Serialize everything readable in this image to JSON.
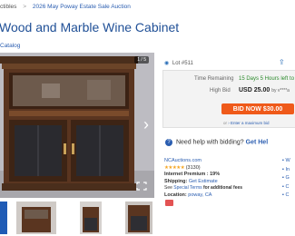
{
  "breadcrumb": {
    "items": [
      "ctibles",
      "2026 May Poway Estate Sale Auction"
    ]
  },
  "listing": {
    "title": "Wood and Marble Wine Cabinet",
    "catalog_link": "Catalog"
  },
  "gallery": {
    "counter": "1 / 5"
  },
  "lot": {
    "number": "Lot #511"
  },
  "bidding": {
    "time_remaining_label": "Time Remaining",
    "time_remaining_value": "15 Days 5 Hours left to",
    "high_bid_label": "High Bid",
    "high_bid_value": "USD 25.00",
    "high_bid_by": "by v****a",
    "bid_now_label": "BID NOW $30.00",
    "or_text": "or",
    "max_bid_link": "Enter a maximum bid"
  },
  "help": {
    "text": "Need help with bidding?",
    "link": "Get Hel"
  },
  "seller": {
    "name": "NCAuctions.com",
    "stars": "★★★★★",
    "rating_count": "(3130)",
    "premium": "Internet Premium : 19%",
    "shipping_label": "Shipping:",
    "shipping_value": "Get Estimate",
    "terms_see": "See",
    "terms_link": "Special Terms",
    "terms_rest": "for additional fees",
    "location_label": "Location:",
    "location_value": "poway, CA"
  },
  "right_links": [
    "W",
    "In",
    "G",
    "C",
    "C"
  ],
  "colors": {
    "link": "#2a5db0",
    "title": "#1f4f96",
    "accent_green": "#2b8a2b",
    "bid_button": "#ef5a1a"
  }
}
